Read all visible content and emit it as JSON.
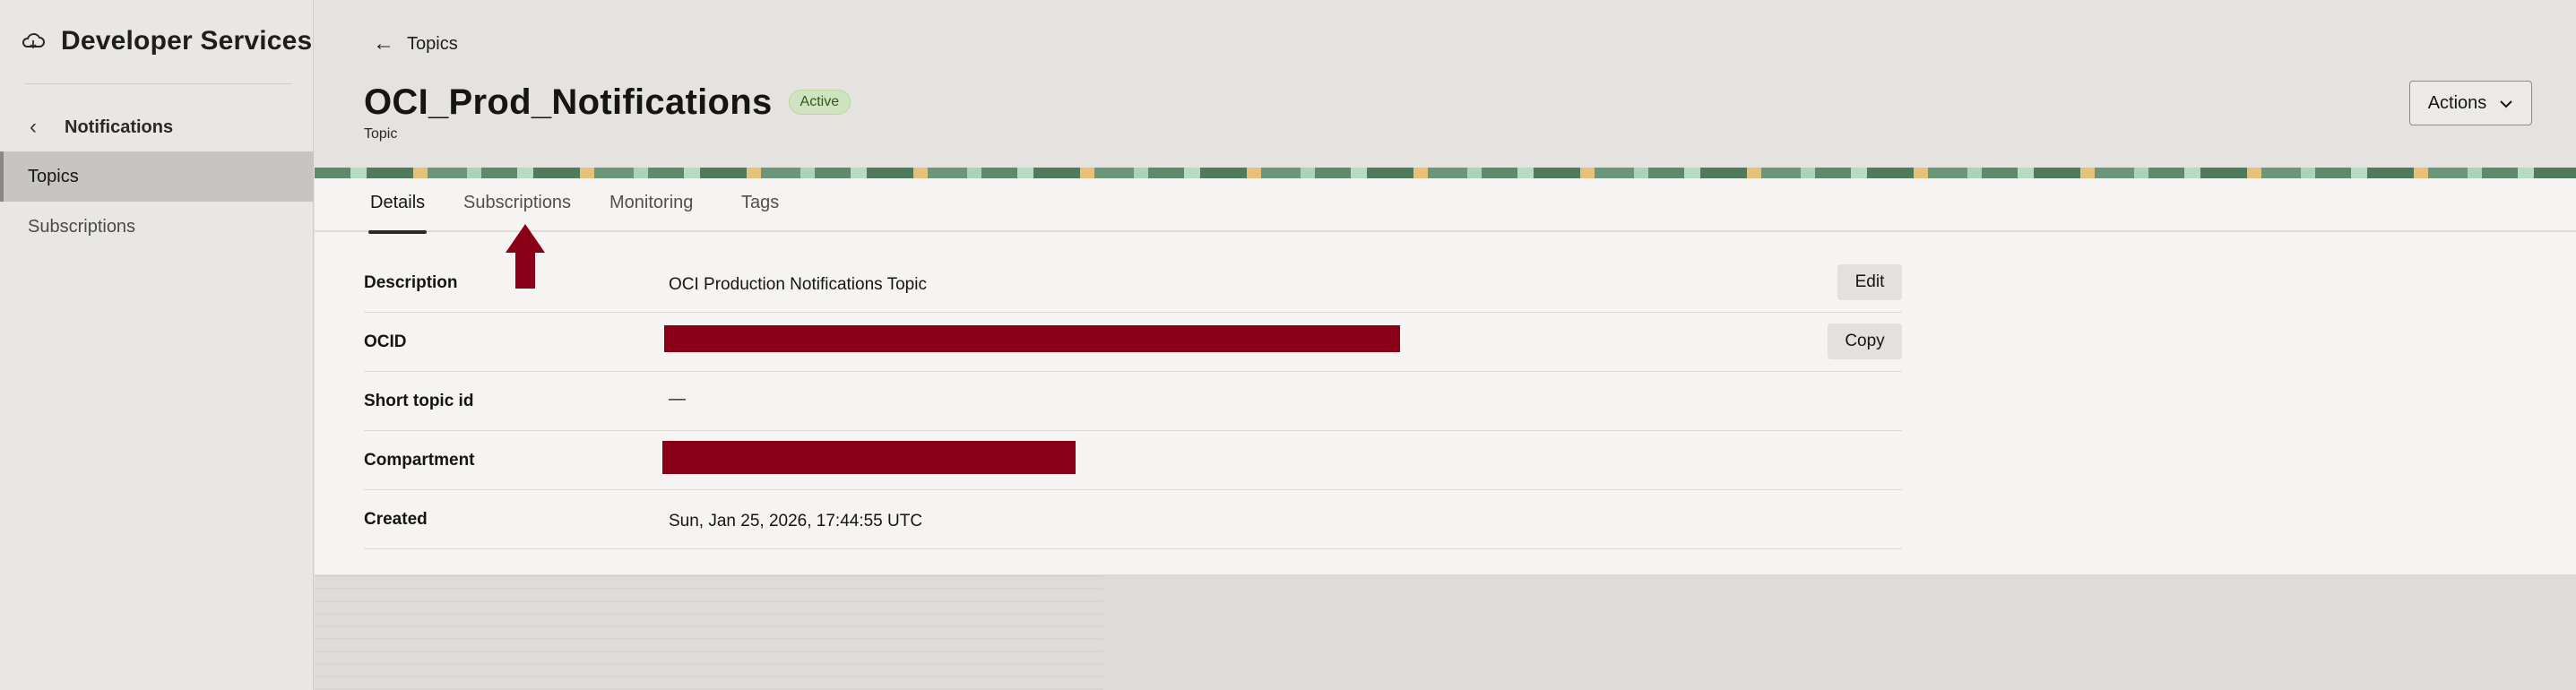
{
  "sidebar": {
    "brand_title": "Developer Services",
    "back_label": "Notifications",
    "items": [
      {
        "label": "Topics",
        "active": true
      },
      {
        "label": "Subscriptions",
        "active": false
      }
    ]
  },
  "header": {
    "breadcrumb": "Topics",
    "title": "OCI_Prod_Notifications",
    "status": "Active",
    "subtitle": "Topic",
    "actions_label": "Actions"
  },
  "tabs": [
    {
      "label": "Details",
      "active": true
    },
    {
      "label": "Subscriptions",
      "active": false
    },
    {
      "label": "Monitoring",
      "active": false
    },
    {
      "label": "Tags",
      "active": false
    }
  ],
  "details": {
    "description_label": "Description",
    "description_value": "OCI Production Notifications Topic",
    "edit_label": "Edit",
    "ocid_label": "OCID",
    "copy_label": "Copy",
    "short_topic_id_label": "Short topic id",
    "short_topic_id_value": "—",
    "compartment_label": "Compartment",
    "created_label": "Created",
    "created_value": "Sun, Jan 25, 2026, 17:44:55 UTC"
  },
  "colors": {
    "redaction": "#8a0016",
    "annotation_arrow": "#8a0016",
    "status_badge": "#cfe3c1"
  }
}
